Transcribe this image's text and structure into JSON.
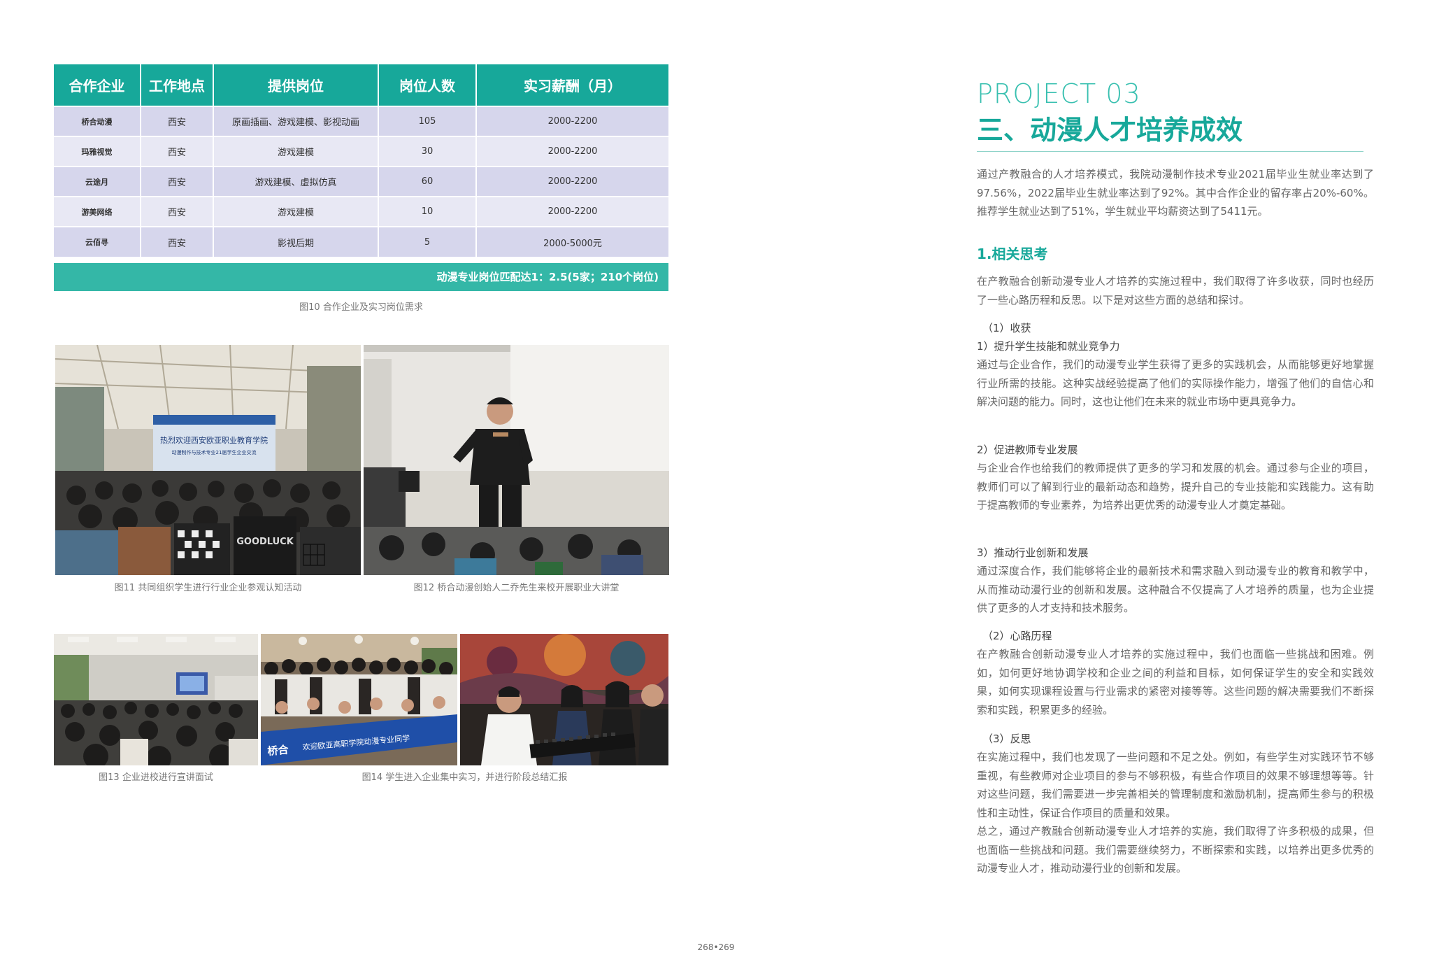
{
  "table": {
    "headers": [
      "合作企业",
      "工作地点",
      "提供岗位",
      "岗位人数",
      "实习薪酬（月）"
    ],
    "rows": [
      [
        "桥合动漫",
        "西安",
        "原画插画、游戏建模、影视动画",
        "105",
        "2000-2200"
      ],
      [
        "玛雅视觉",
        "西安",
        "游戏建模",
        "30",
        "2000-2200"
      ],
      [
        "云途月",
        "西安",
        "游戏建模、虚拟仿真",
        "60",
        "2000-2200"
      ],
      [
        "游美网络",
        "西安",
        "游戏建模",
        "10",
        "2000-2200"
      ],
      [
        "云佰寻",
        "西安",
        "影视后期",
        "5",
        "2000-5000元"
      ]
    ],
    "footer": "动漫专业岗位匹配达1：2.5(5家；210个岗位)"
  },
  "captions": {
    "fig10": "图10 合作企业及实习岗位需求",
    "fig11": "图11 共同组织学生进行行业企业参观认知活动",
    "fig12": "图12 桥合动漫创始人二乔先生来校开展职业大讲堂",
    "fig13": "图13 企业进校进行宣讲面试",
    "fig14": "图14 学生进入企业集中实习，并进行阶段总结汇报"
  },
  "photos": {
    "p11_banner": "热烈欢迎西安欧亚职业教育学院",
    "p11_banner_sub": "动漫制作与技术专业21届学生企业交流",
    "p11_jacket": "GOODLUCK",
    "p14_logo": "桥合",
    "p14_banner": "欢迎欧亚高职学院动漫专业同学"
  },
  "right": {
    "project_label": "PROJECT 03",
    "title": "三、动漫人才培养成效",
    "intro": "通过产教融合的人才培养模式，我院动漫制作技术专业2021届毕业生就业率达到了97.56%，2022届毕业生就业率达到了92%。其中合作企业的留存率占20%-60%。推荐学生就业达到了51%，学生就业平均薪资达到了5411元。",
    "s1_title": "1.相关思考",
    "s1_text": "在产教融合创新动漫专业人才培养的实施过程中，我们取得了许多收获，同时也经历了一些心路历程和反思。以下是对这些方面的总结和探讨。",
    "harvest_title": "（1）收获",
    "h1_title": "1）提升学生技能和就业竞争力",
    "h1_text": "通过与企业合作，我们的动漫专业学生获得了更多的实践机会，从而能够更好地掌握行业所需的技能。这种实战经验提高了他们的实际操作能力，增强了他们的自信心和解决问题的能力。同时，这也让他们在未来的就业市场中更具竞争力。",
    "h2_title": "2）促进教师专业发展",
    "h2_text": "与企业合作也给我们的教师提供了更多的学习和发展的机会。通过参与企业的项目，教师们可以了解到行业的最新动态和趋势，提升自己的专业技能和实践能力。这有助于提高教师的专业素养，为培养出更优秀的动漫专业人才奠定基础。",
    "h3_title": "3）推动行业创新和发展",
    "h3_text": "通过深度合作，我们能够将企业的最新技术和需求融入到动漫专业的教育和教学中，从而推动动漫行业的创新和发展。这种融合不仅提高了人才培养的质量，也为企业提供了更多的人才支持和技术服务。",
    "journey_title": "（2）心路历程",
    "journey_text": "在产教融合创新动漫专业人才培养的实施过程中，我们也面临一些挑战和困难。例如，如何更好地协调学校和企业之间的利益和目标，如何保证学生的安全和实践效果，如何实现课程设置与行业需求的紧密对接等等。这些问题的解决需要我们不断探索和实践，积累更多的经验。",
    "reflect_title": "（3）反思",
    "reflect_text": "在实施过程中，我们也发现了一些问题和不足之处。例如，有些学生对实践环节不够重视，有些教师对企业项目的参与不够积极，有些合作项目的效果不够理想等等。针对这些问题，我们需要进一步完善相关的管理制度和激励机制，提高师生参与的积极性和主动性，保证合作项目的质量和效果。",
    "summary_text": "总之，通过产教融合创新动漫专业人才培养的实施，我们取得了许多积极的成果，但也面临一些挑战和问题。我们需要继续努力，不断探索和实践，以培养出更多优秀的动漫专业人才，推动动漫行业的创新和发展。"
  },
  "page_number": "268•269",
  "colors": {
    "teal": "#17a89a",
    "teal_light": "#34b7a7",
    "row_a": "#d6d6ec",
    "row_b": "#e8e8f4"
  }
}
